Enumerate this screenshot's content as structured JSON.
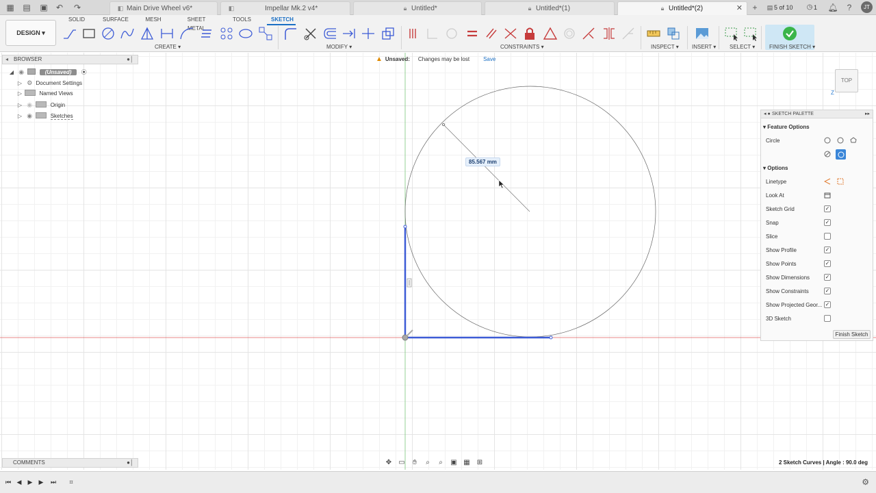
{
  "tabs": [
    {
      "label": "Main Drive Wheel v6*",
      "active": false
    },
    {
      "label": "Impellar Mk.2 v4*",
      "active": false
    },
    {
      "label": "Untitled*",
      "active": false
    },
    {
      "label": "Untitled*(1)",
      "active": false
    },
    {
      "label": "Untitled*(2)",
      "active": true
    }
  ],
  "tab_bar": {
    "page_counter": "5 of 10",
    "notifications": "1",
    "user_initials": "JT"
  },
  "ribbon": {
    "workspace": "DESIGN",
    "tabs": [
      "SOLID",
      "SURFACE",
      "MESH",
      "SHEET METAL",
      "TOOLS",
      "SKETCH"
    ],
    "active_tab": "SKETCH",
    "groups": {
      "create": "CREATE",
      "modify": "MODIFY",
      "constraints": "CONSTRAINTS",
      "inspect": "INSPECT",
      "insert": "INSERT",
      "select": "SELECT",
      "finish": "FINISH SKETCH"
    },
    "accent": "#2c8ddb"
  },
  "browser": {
    "title": "BROWSER",
    "items": [
      {
        "label": "(Unsaved)"
      },
      {
        "label": "Document Settings"
      },
      {
        "label": "Named Views"
      },
      {
        "label": "Origin"
      },
      {
        "label": "Sketches"
      }
    ]
  },
  "banner": {
    "title": "Unsaved:",
    "message": "Changes may be lost",
    "action": "Save"
  },
  "viewcube": {
    "face": "TOP",
    "axis": "Z"
  },
  "dimension": {
    "label": "85.567 mm"
  },
  "palette": {
    "title": "SKETCH PALETTE",
    "feature_section": "Feature Options",
    "circle_label": "Circle",
    "options_section": "Options",
    "linetype": "Linetype",
    "look_at": "Look At",
    "toggles": [
      {
        "label": "Sketch Grid",
        "checked": true
      },
      {
        "label": "Snap",
        "checked": true
      },
      {
        "label": "Slice",
        "checked": false
      },
      {
        "label": "Show Profile",
        "checked": true
      },
      {
        "label": "Show Points",
        "checked": true
      },
      {
        "label": "Show Dimensions",
        "checked": true
      },
      {
        "label": "Show Constraints",
        "checked": true
      },
      {
        "label": "Show Projected Geor...",
        "checked": true
      },
      {
        "label": "3D Sketch",
        "checked": false
      }
    ],
    "finish_button": "Finish Sketch"
  },
  "comments": {
    "title": "COMMENTS"
  },
  "status": {
    "text": "2 Sketch Curves | Angle : 90.0 deg"
  },
  "colors": {
    "sketch_line": "#3c5bd6",
    "x_axis": "#e06060",
    "y_axis": "#7ac77a"
  }
}
